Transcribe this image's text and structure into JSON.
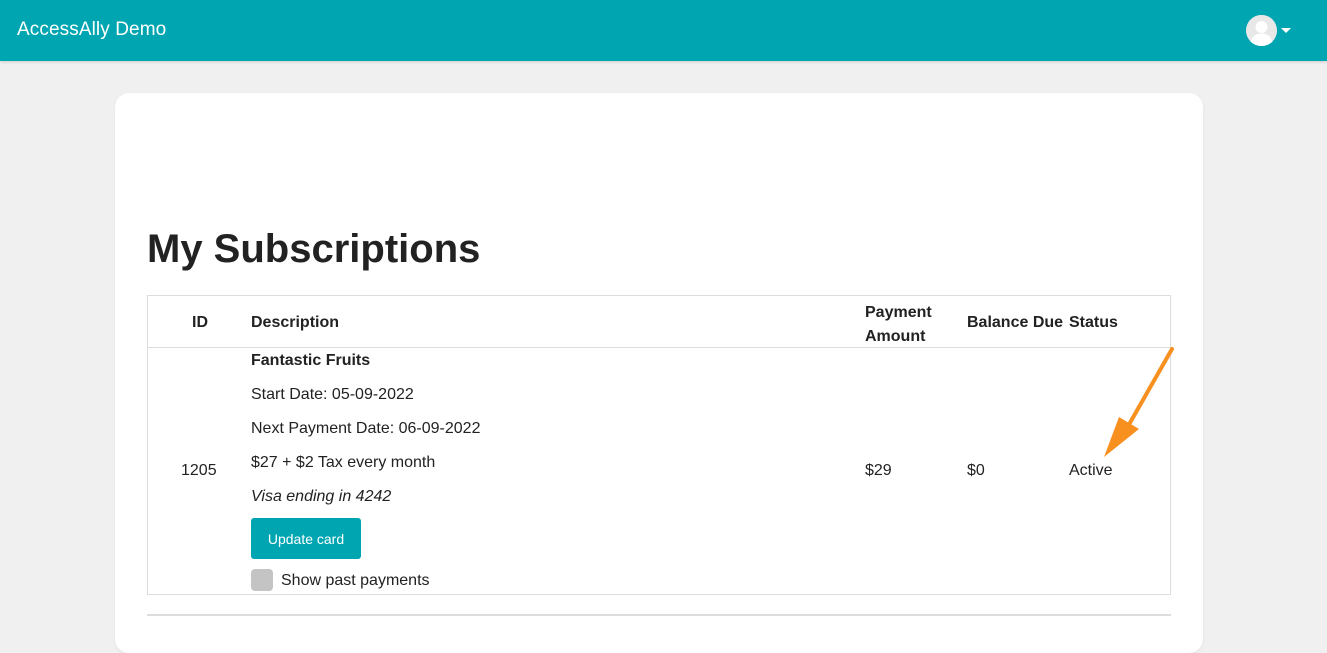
{
  "header": {
    "brand": "AccessAlly Demo",
    "accent_color": "#00a5b2",
    "user_icon": "user-avatar-icon",
    "menu_icon": "caret-down-icon"
  },
  "page": {
    "title": "My Subscriptions"
  },
  "table": {
    "columns": {
      "id": "ID",
      "description": "Description",
      "payment_amount": "Payment Amount",
      "balance_due": "Balance Due",
      "status": "Status"
    },
    "rows": [
      {
        "id": "1205",
        "product_name": "Fantastic Fruits",
        "start_date": "Start Date: 05-09-2022",
        "next_payment": "Next Payment Date: 06-09-2022",
        "price": "$27 + $2 Tax every month",
        "card": "Visa ending in 4242",
        "update_button": "Update card",
        "past_payments_label": "Show past payments",
        "past_payments_checked": false,
        "payment_amount": "$29",
        "balance_due": "$0",
        "status": "Active"
      }
    ]
  },
  "annotation": {
    "arrow_color": "#f7901e",
    "arrow_icon": "arrow-pointer-icon"
  }
}
